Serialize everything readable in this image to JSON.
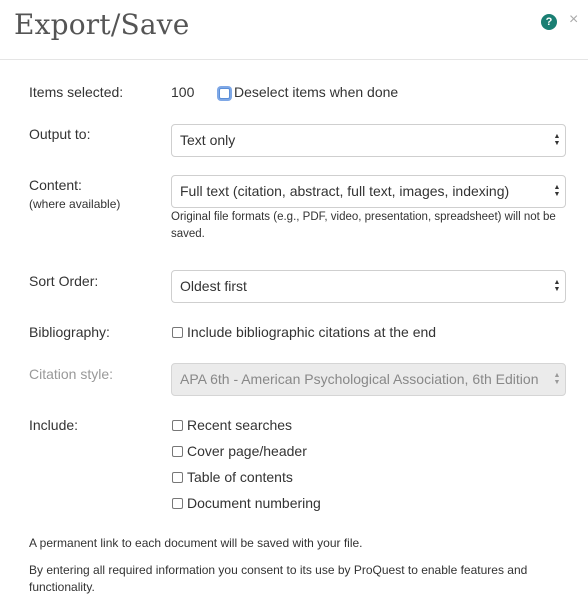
{
  "dialog": {
    "title": "Export/Save",
    "help_icon": "question-circle-icon",
    "close_icon": "close-x-icon",
    "help_glyph": "?",
    "close_glyph": "×"
  },
  "items_selected": {
    "label": "Items selected:",
    "count": "100",
    "deselect_label": "Deselect items when done",
    "deselect_checked": false
  },
  "output": {
    "label": "Output to:",
    "selected": "Text only"
  },
  "content": {
    "label": "Content:",
    "sublabel": "(where available)",
    "selected": "Full text (citation, abstract, full text, images, indexing)",
    "note": "Original file formats (e.g., PDF, video, presentation, spreadsheet) will not be saved."
  },
  "sort_order": {
    "label": "Sort Order:",
    "selected": "Oldest first"
  },
  "bibliography": {
    "label": "Bibliography:",
    "checkbox_label": "Include bibliographic citations at the end",
    "checked": false
  },
  "citation_style": {
    "label": "Citation style:",
    "selected": "APA 6th - American Psychological Association, 6th Edition",
    "disabled": true
  },
  "include": {
    "label": "Include:",
    "options": [
      {
        "label": "Recent searches",
        "checked": false
      },
      {
        "label": "Cover page/header",
        "checked": false
      },
      {
        "label": "Table of contents",
        "checked": false
      },
      {
        "label": "Document numbering",
        "checked": false
      }
    ]
  },
  "footer": {
    "permalink_note": "A permanent link to each document will be saved with your file.",
    "consent_note": "By entering all required information you consent to its use by ProQuest to enable features and functionality."
  }
}
